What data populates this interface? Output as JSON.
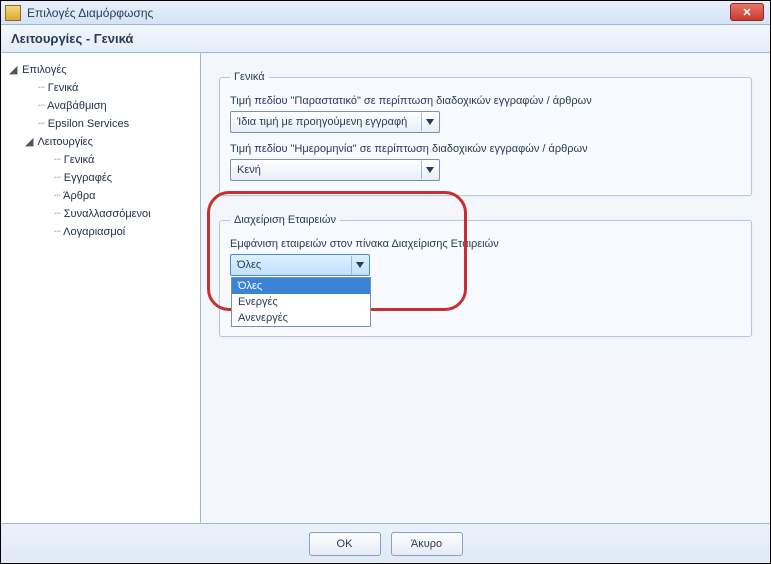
{
  "window": {
    "title": "Επιλογές Διαμόρφωσης",
    "close_glyph": "✕"
  },
  "header": {
    "title": "Λειτουργίες - Γενικά"
  },
  "sidebar": {
    "root": {
      "label": "Επιλογές",
      "expanded": true,
      "children": [
        {
          "label": "Γενικά"
        },
        {
          "label": "Αναβάθμιση"
        },
        {
          "label": "Epsilon Services"
        },
        {
          "label": "Λειτουργίες",
          "expanded": true,
          "children": [
            {
              "label": "Γενικά"
            },
            {
              "label": "Εγγραφές"
            },
            {
              "label": "Άρθρα"
            },
            {
              "label": "Συναλλασσόμενοι"
            },
            {
              "label": "Λογαριασμοί"
            }
          ]
        }
      ]
    }
  },
  "main": {
    "group_general": {
      "legend": "Γενικά",
      "field1_label": "Τιμή πεδίου \"Παραστατικό\" σε περίπτωση διαδοχικών εγγραφών / άρθρων",
      "field1_value": "Ίδια τιμή με προηγούμενη εγγραφή",
      "field2_label": "Τιμή πεδίου \"Ημερομηνία\" σε περίπτωση διαδοχικών εγγραφών / άρθρων",
      "field2_value": "Κενή"
    },
    "group_companies": {
      "legend": "Διαχείριση Εταιρειών",
      "field_label": "Εμφάνιση εταιρειών στον πίνακα Διαχείρισης Εταιρειών",
      "selected": "Όλες",
      "options": [
        "Όλες",
        "Ενεργές",
        "Ανενεργές"
      ]
    }
  },
  "footer": {
    "ok": "OK",
    "cancel": "Άκυρο"
  },
  "icons": {
    "expander_open": "◢",
    "expander_closed": "▸"
  }
}
